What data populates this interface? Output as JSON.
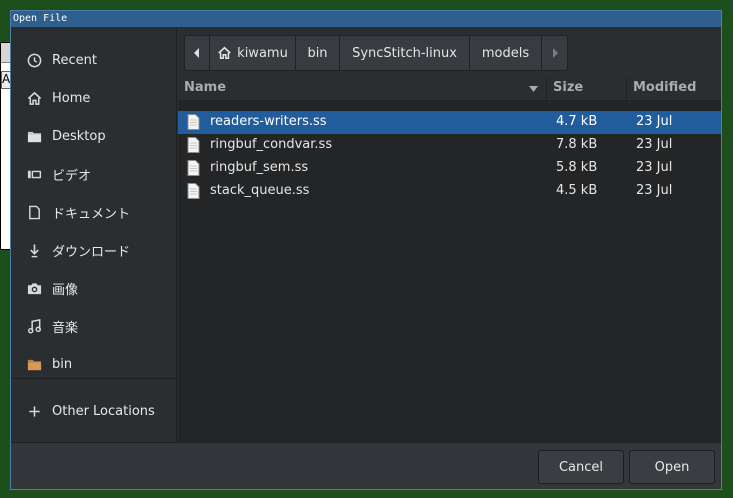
{
  "background_app": {
    "fragment_text": "As"
  },
  "window": {
    "title": "Open File"
  },
  "sidebar": {
    "items": [
      {
        "label": "Recent",
        "icon": "clock-icon"
      },
      {
        "label": "Home",
        "icon": "home-icon"
      },
      {
        "label": "Desktop",
        "icon": "folder-icon"
      },
      {
        "label": "ビデオ",
        "icon": "video-icon"
      },
      {
        "label": "ドキュメント",
        "icon": "document-icon"
      },
      {
        "label": "ダウンロード",
        "icon": "download-icon"
      },
      {
        "label": "画像",
        "icon": "camera-icon"
      },
      {
        "label": "音楽",
        "icon": "music-icon"
      },
      {
        "label": "bin",
        "icon": "folder-icon"
      }
    ],
    "other_locations": {
      "label": "Other Locations",
      "icon": "plus-icon"
    }
  },
  "pathbar": {
    "crumbs": [
      "kiwamu",
      "bin",
      "SyncStitch-linux",
      "models"
    ]
  },
  "file_list": {
    "columns": {
      "name": "Name",
      "size": "Size",
      "modified": "Modified"
    },
    "sort": {
      "column": "Name",
      "direction": "descending"
    },
    "rows": [
      {
        "name": "readers-writers.ss",
        "size": "4.7 kB",
        "modified": "23 Jul",
        "selected": true
      },
      {
        "name": "ringbuf_condvar.ss",
        "size": "7.8 kB",
        "modified": "23 Jul",
        "selected": false
      },
      {
        "name": "ringbuf_sem.ss",
        "size": "5.8 kB",
        "modified": "23 Jul",
        "selected": false
      },
      {
        "name": "stack_queue.ss",
        "size": "4.5 kB",
        "modified": "23 Jul",
        "selected": false
      }
    ]
  },
  "buttons": {
    "cancel": "Cancel",
    "open": "Open"
  },
  "colors": {
    "desktop": "#1d4f1d",
    "titlebar": "#2f5f8e",
    "selection": "#215d9c",
    "window_bg": "#2b2e31"
  }
}
